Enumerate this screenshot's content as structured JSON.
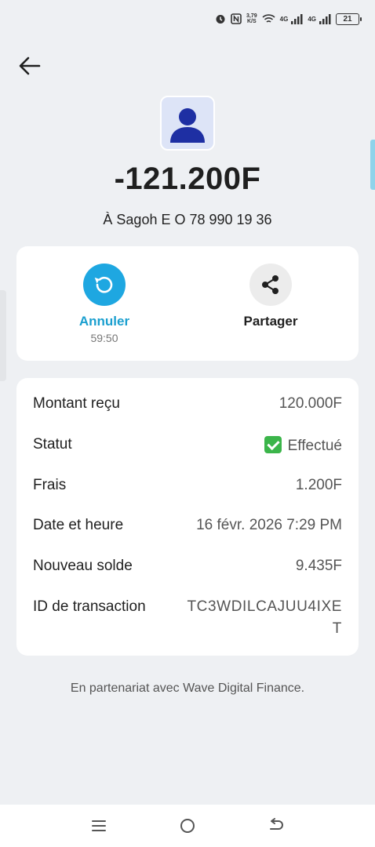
{
  "status_bar": {
    "speed_value": "3,79",
    "speed_unit": "K/S",
    "network_1": "4G",
    "network_2": "4G",
    "battery": "21"
  },
  "header": {
    "back_icon": "arrow-left-icon"
  },
  "transaction": {
    "avatar_icon": "person-icon",
    "amount": "-121.200F",
    "recipient": "À Sagoh E O 78 990 19 36"
  },
  "actions": {
    "cancel_label": "Annuler",
    "cancel_timer": "59:50",
    "cancel_icon": "undo-icon",
    "share_label": "Partager",
    "share_icon": "share-icon"
  },
  "details": {
    "rows": [
      {
        "label": "Montant reçu",
        "value": "120.000F"
      },
      {
        "label": "Statut",
        "value": "Effectué"
      },
      {
        "label": "Frais",
        "value": "1.200F"
      },
      {
        "label": "Date et heure",
        "value": "16 févr. 2026 7:29 PM"
      },
      {
        "label": "Nouveau solde",
        "value": "9.435F"
      },
      {
        "label": "ID de transaction",
        "value": "TC3WDILCAJUU4IXET"
      }
    ],
    "status_color": "#3bb54a"
  },
  "footer": {
    "partner_text": "En partenariat avec Wave Digital Finance."
  },
  "nav_bar": {
    "menu_icon": "menu-icon",
    "home_icon": "home-circle-icon",
    "back_icon": "back-icon"
  },
  "colors": {
    "accent": "#1ea7e1",
    "background": "#eef0f3",
    "avatar_bg": "#dde4f7",
    "avatar_fg": "#1e2fa3"
  }
}
